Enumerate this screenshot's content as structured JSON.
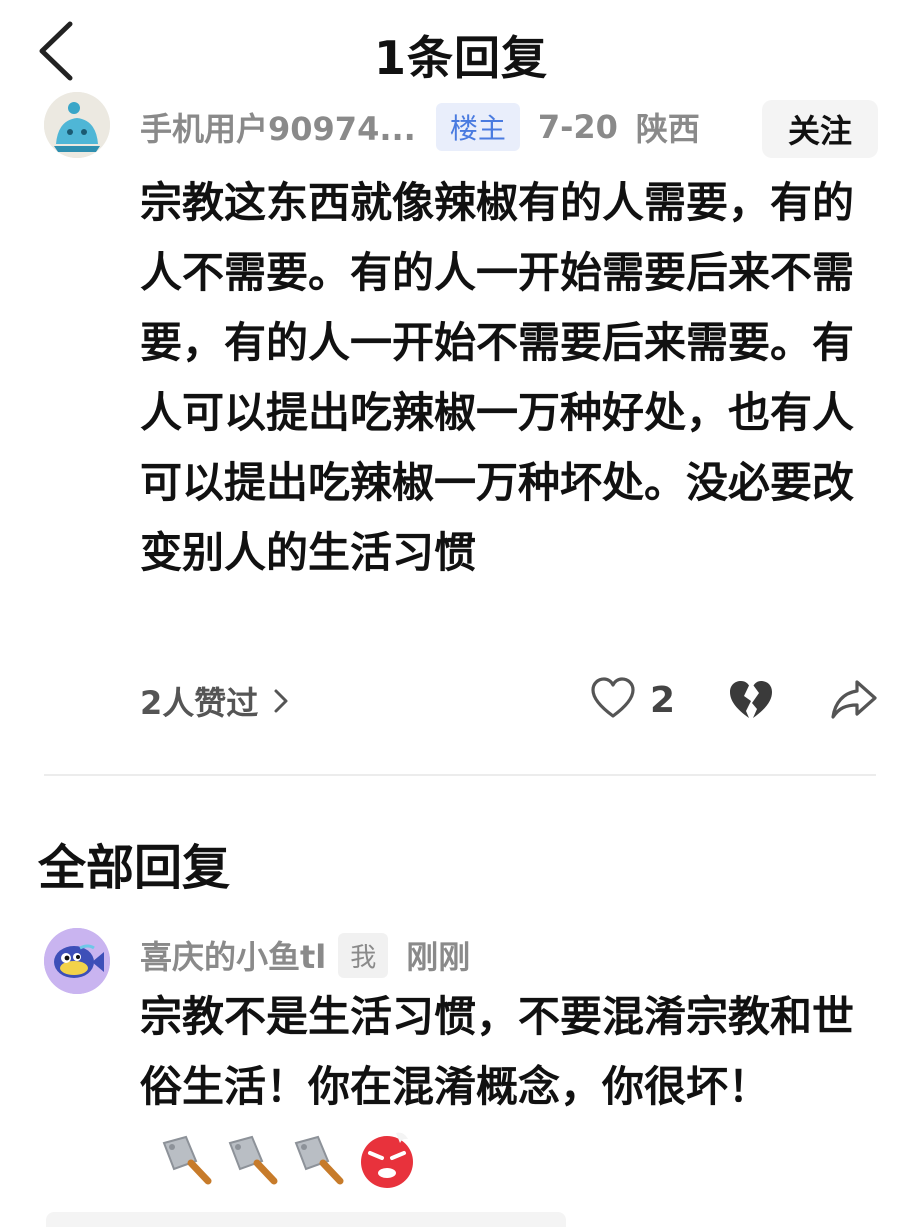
{
  "header": {
    "title": "1条回复"
  },
  "main_comment": {
    "username": "手机用户90974...",
    "owner_tag": "楼主",
    "date": "7-20",
    "location": "陕西",
    "follow_label": "关注",
    "content": "宗教这东西就像辣椒有的人需要，有的人不需要。有的人一开始需要后来不需要，有的人一开始不需要后来需要。有人可以提出吃辣椒一万种好处，也有人可以提出吃辣椒一万种坏处。没必要改变别人的生活习惯",
    "likes_text": "2人赞过",
    "like_count": "2"
  },
  "section_title": "全部回复",
  "reply": {
    "username": "喜庆的小鱼tl",
    "me_tag": "我",
    "time": "刚刚",
    "content": "宗教不是生活习惯，不要混淆宗教和世俗生活！你在混淆概念，你很坏！",
    "emojis": [
      "cleaver-emoji",
      "cleaver-emoji",
      "cleaver-emoji",
      "angry-face-emoji"
    ]
  },
  "colors": {
    "owner_tag_bg": "#e9eefb",
    "owner_tag_text": "#4a7be0",
    "meta_gray": "#8a8a8a",
    "emoji_red": "#e8323c"
  }
}
